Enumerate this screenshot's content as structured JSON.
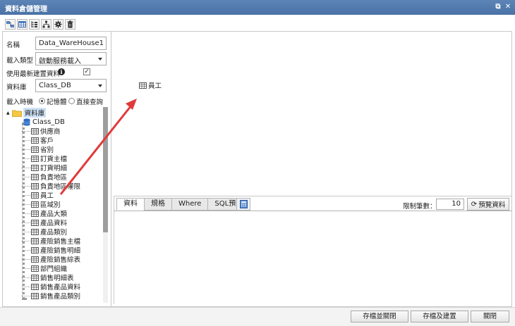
{
  "window": {
    "title": "資料倉儲管理",
    "restore_glyph": "⧉",
    "close_glyph": "✕"
  },
  "toolbar": {
    "icons": [
      "layout-icon",
      "table-icon",
      "tree-icon",
      "hierarchy-icon",
      "gear-icon",
      "trash-icon"
    ]
  },
  "form": {
    "name_label": "名稱",
    "name_value": "Data_WareHouse1",
    "import_type_label": "載入類型",
    "import_type_value": "啟動服務載入",
    "use_latest_label": "使用最新建置資料",
    "use_latest_checked": "✓",
    "info_glyph": "i",
    "database_label": "資料庫",
    "database_value": "Class_DB",
    "load_time_label": "載入時機",
    "radio_memory": "記憶體",
    "radio_direct": "直接查詢"
  },
  "tree": {
    "root_label": "資料庫",
    "collapse_glyph": "▲",
    "db_name": "Class_DB",
    "tables": [
      "供應商",
      "客戶",
      "省別",
      "訂貨主檔",
      "訂貨明細",
      "負責地區",
      "負責地區權限",
      "員工",
      "區域別",
      "產品大類",
      "產品資料",
      "產品類別",
      "產險銷售主檔",
      "產險銷售明細",
      "產險銷售綜表",
      "部門組織",
      "銷售明細表",
      "銷售產品資料",
      "銷售產品類別"
    ]
  },
  "canvas": {
    "node_label": "員工",
    "accent_color": "#e03a3a"
  },
  "bottom": {
    "tabs": [
      "資料",
      "規格",
      "Where",
      "SQL預覽"
    ],
    "active_tab": "資料",
    "limit_label": "限制筆數：",
    "limit_value": "10",
    "preview_label": "預覽資料"
  },
  "footer": {
    "save_close": "存檔並關閉",
    "save_build": "存檔及建置",
    "close": "關閉"
  }
}
